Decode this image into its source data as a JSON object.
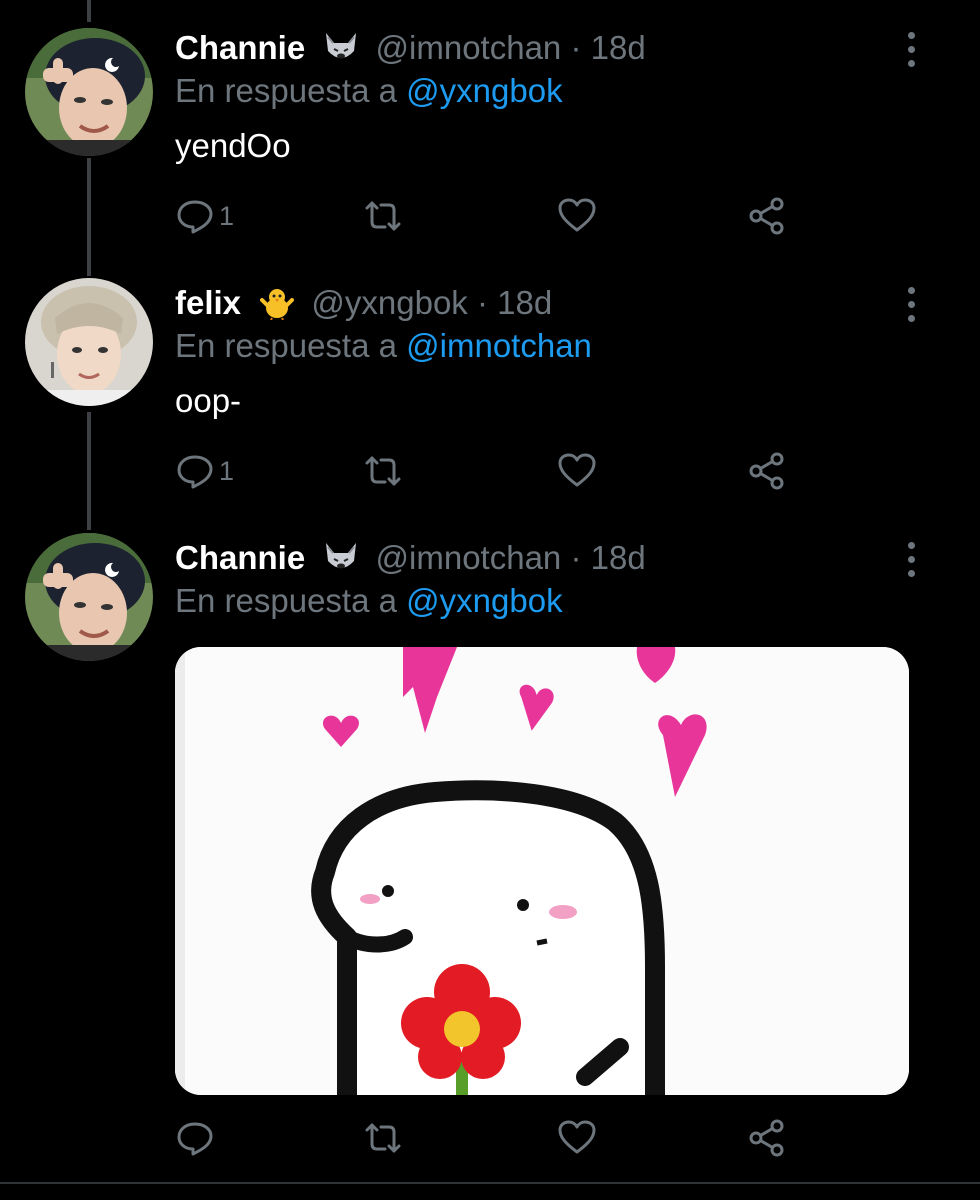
{
  "tweets": [
    {
      "display_name": "Channie",
      "emoji_icon": "wolf-emoji",
      "handle": "@imnotchan",
      "dot": "·",
      "time": "18d",
      "reply_prefix": "En respuesta a",
      "reply_to": "@yxngbok",
      "text": "yendOo",
      "reply_count": "1"
    },
    {
      "display_name": "felix",
      "emoji_icon": "baby-chick-emoji",
      "handle": "@yxngbok",
      "dot": "·",
      "time": "18d",
      "reply_prefix": "En respuesta a",
      "reply_to": "@imnotchan",
      "text": "oop-",
      "reply_count": "1"
    },
    {
      "display_name": "Channie",
      "emoji_icon": "wolf-emoji",
      "handle": "@imnotchan",
      "dot": "·",
      "time": "18d",
      "reply_prefix": "En respuesta a",
      "reply_to": "@yxngbok",
      "media": "meme-image-blob-with-flower-and-hearts"
    }
  ],
  "colors": {
    "background": "#000000",
    "secondary_text": "#6e767d",
    "mention": "#1d9bf0",
    "thread_line": "#3d4044"
  }
}
